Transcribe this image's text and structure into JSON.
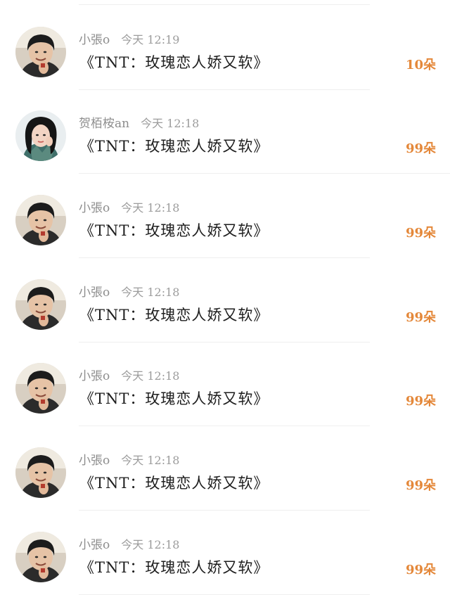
{
  "gift_list": {
    "items": [
      {
        "user": "小張o",
        "time": "今天  12:19",
        "gift": "《TNT：玫瑰恋人娇又软》",
        "count": "10朵",
        "avatar": "boy"
      },
      {
        "user": "贺栢桉an",
        "time": "今天  12:18",
        "gift": "《TNT：玫瑰恋人娇又软》",
        "count": "99朵",
        "avatar": "girl"
      },
      {
        "user": "小張o",
        "time": "今天  12:18",
        "gift": "《TNT：玫瑰恋人娇又软》",
        "count": "99朵",
        "avatar": "boy"
      },
      {
        "user": "小張o",
        "time": "今天  12:18",
        "gift": "《TNT：玫瑰恋人娇又软》",
        "count": "99朵",
        "avatar": "boy"
      },
      {
        "user": "小張o",
        "time": "今天  12:18",
        "gift": "《TNT：玫瑰恋人娇又软》",
        "count": "99朵",
        "avatar": "boy"
      },
      {
        "user": "小張o",
        "time": "今天  12:18",
        "gift": "《TNT：玫瑰恋人娇又软》",
        "count": "99朵",
        "avatar": "boy"
      },
      {
        "user": "小張o",
        "time": "今天  12:18",
        "gift": "《TNT：玫瑰恋人娇又软》",
        "count": "99朵",
        "avatar": "boy"
      }
    ]
  },
  "colors": {
    "count_accent": "#e4883a",
    "meta_gray": "#8d8d8d",
    "text_dark": "#1e1e1e"
  }
}
